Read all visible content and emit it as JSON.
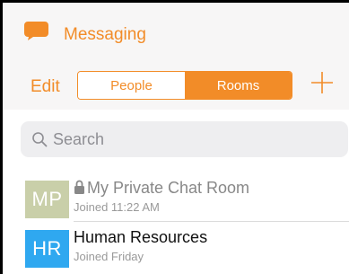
{
  "header": {
    "title": "Messaging",
    "app_icon": "chat-bubble-icon",
    "accent_color": "#f28c28"
  },
  "toolbar": {
    "edit_label": "Edit",
    "segments": [
      {
        "label": "People",
        "selected": false
      },
      {
        "label": "Rooms",
        "selected": true
      }
    ],
    "add_icon": "plus-icon"
  },
  "search": {
    "placeholder": "Search",
    "icon": "search-icon"
  },
  "rooms": [
    {
      "initials": "MP",
      "name": "My Private Chat Room",
      "status": "Joined 11:22 AM",
      "locked": true,
      "avatar_color": "#c9cfa9"
    },
    {
      "initials": "HR",
      "name": "Human Resources",
      "status": "Joined Friday",
      "locked": false,
      "avatar_color": "#2fa8f0"
    }
  ]
}
